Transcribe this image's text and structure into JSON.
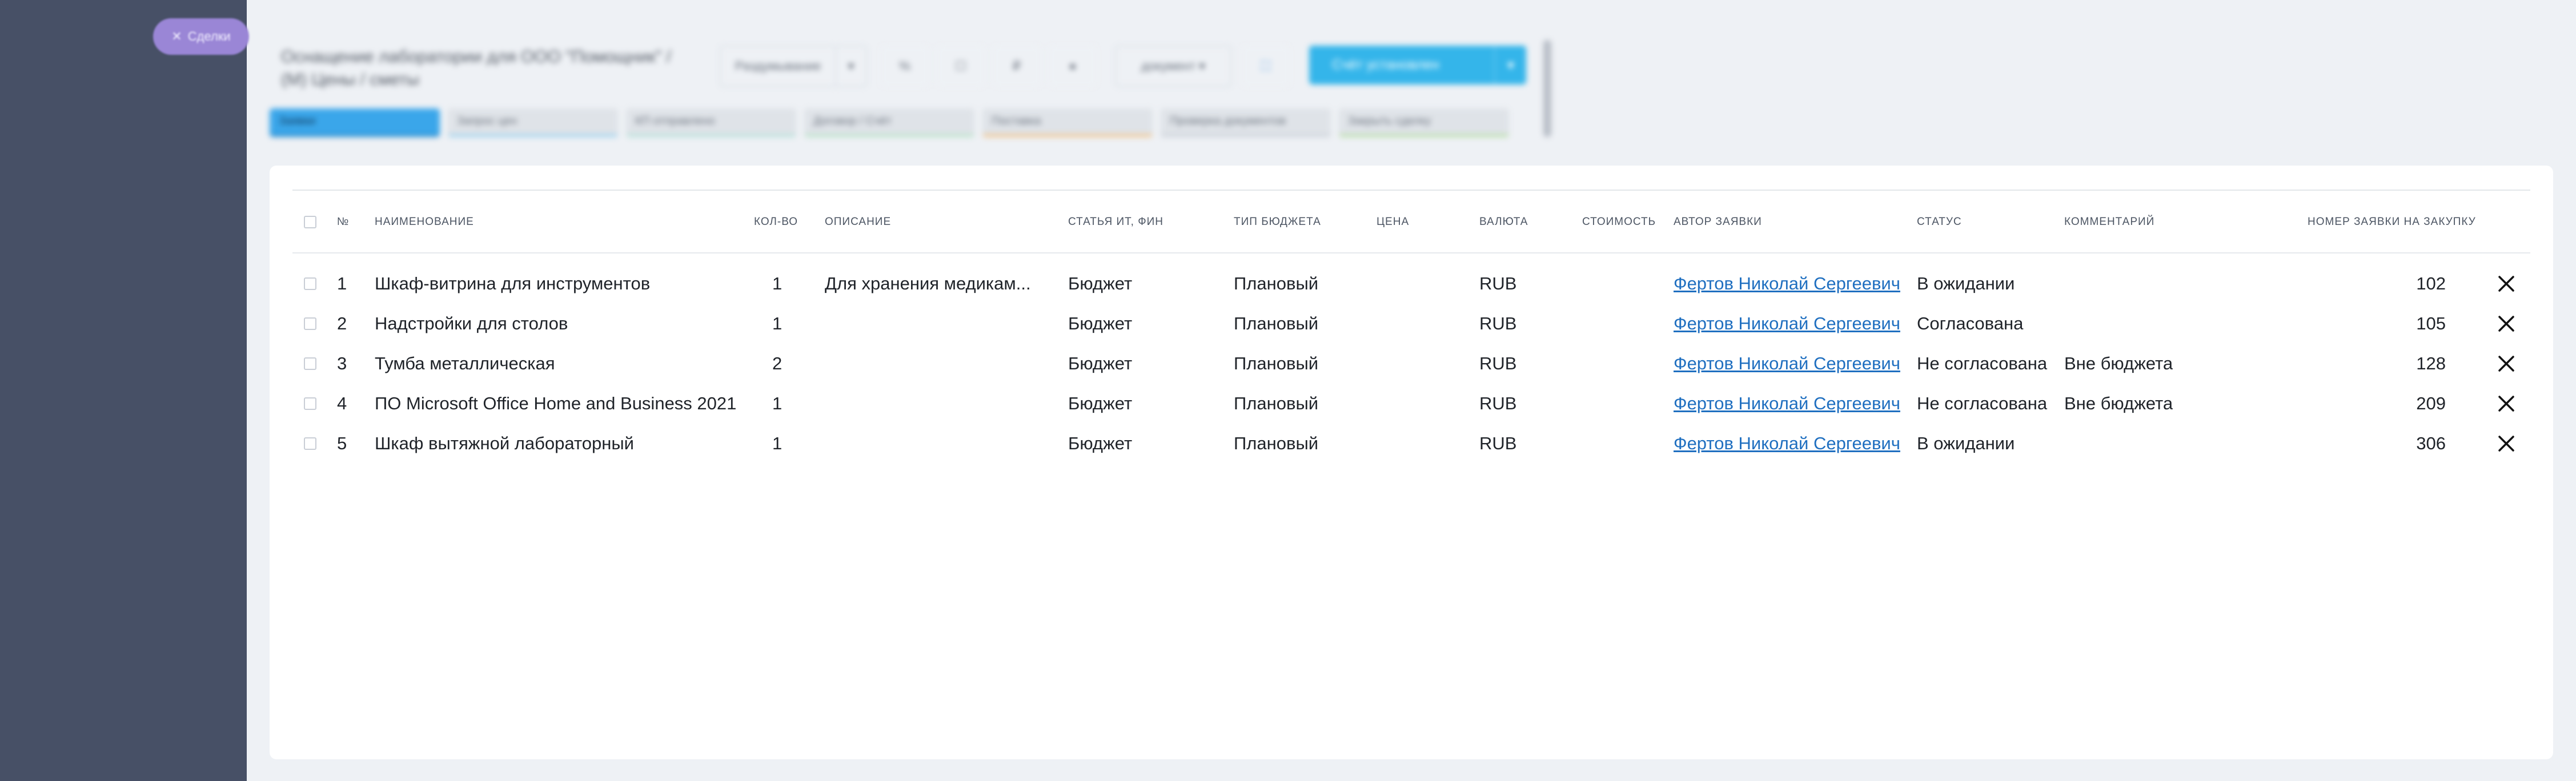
{
  "sidebar": {
    "pill_icon": "close-icon",
    "pill_label": "Сделки"
  },
  "header": {
    "title": "Оснащение лаборатории для ООО \"Помощник\" / (M) Цены / сметы",
    "toolbar": {
      "dropdown1": "Раздумывание",
      "dropdown2": "документ",
      "primary_label": "Счёт установлен"
    },
    "stages": [
      {
        "label": "Заявки",
        "active": true,
        "color": "#3aa6ea"
      },
      {
        "label": "Запрос цен",
        "color": "#9fd3ef"
      },
      {
        "label": "КП отправлено",
        "color": "#b6e1d9"
      },
      {
        "label": "Договор / Счёт",
        "color": "#b9e3c8"
      },
      {
        "label": "Поставка",
        "color": "#f2c48a"
      },
      {
        "label": "Проверка документов",
        "color": "#cdd3da"
      },
      {
        "label": "Закрыть сделку",
        "color": "#b9dfa8"
      }
    ]
  },
  "table": {
    "headers": {
      "num": "№",
      "name": "НАИМЕНОВАНИЕ",
      "qty": "КОЛ-ВО",
      "desc": "ОПИСАНИЕ",
      "article": "СТАТЬЯ ИТ, ФИН",
      "budget": "ТИП БЮДЖЕТА",
      "price": "ЦЕНА",
      "currency": "ВАЛЮТА",
      "cost": "СТОИМОСТЬ",
      "author": "АВТОР ЗАЯВКИ",
      "status": "СТАТУС",
      "comment": "КОММЕНТАРИЙ",
      "order_no": "НОМЕР ЗАЯВКИ НА ЗАКУПКУ"
    },
    "rows": [
      {
        "num": "1",
        "name": "Шкаф-витрина для инструментов",
        "qty": "1",
        "desc": "Для хранения медикам...",
        "article": "Бюджет",
        "budget": "Плановый",
        "price": "",
        "currency": "RUB",
        "cost": "",
        "author": "Фертов Николай Сергеевич",
        "status": "В ожидании",
        "comment": "",
        "order_no": "102"
      },
      {
        "num": "2",
        "name": "Надстройки для столов",
        "qty": "1",
        "desc": "",
        "article": "Бюджет",
        "budget": "Плановый",
        "price": "",
        "currency": "RUB",
        "cost": "",
        "author": "Фертов Николай Сергеевич",
        "status": "Согласована",
        "comment": "",
        "order_no": "105"
      },
      {
        "num": "3",
        "name": "Тумба металлическая",
        "qty": "2",
        "desc": "",
        "article": "Бюджет",
        "budget": "Плановый",
        "price": "",
        "currency": "RUB",
        "cost": "",
        "author": "Фертов Николай Сергеевич",
        "status": "Не согласована",
        "comment": "Вне бюджета",
        "order_no": "128"
      },
      {
        "num": "4",
        "name": "ПО Microsoft Office Home and Business 2021",
        "qty": "1",
        "desc": "",
        "article": "Бюджет",
        "budget": "Плановый",
        "price": "",
        "currency": "RUB",
        "cost": "",
        "author": "Фертов Николай Сергеевич",
        "status": "Не согласована",
        "comment": "Вне бюджета",
        "order_no": "209"
      },
      {
        "num": "5",
        "name": "Шкаф вытяжной лабораторный",
        "qty": "1",
        "desc": "",
        "article": "Бюджет",
        "budget": "Плановый",
        "price": "",
        "currency": "RUB",
        "cost": "",
        "author": "Фертов Николай Сергеевич",
        "status": "В ожидании",
        "comment": "",
        "order_no": "306"
      }
    ],
    "row_action_icon": "close-icon"
  }
}
